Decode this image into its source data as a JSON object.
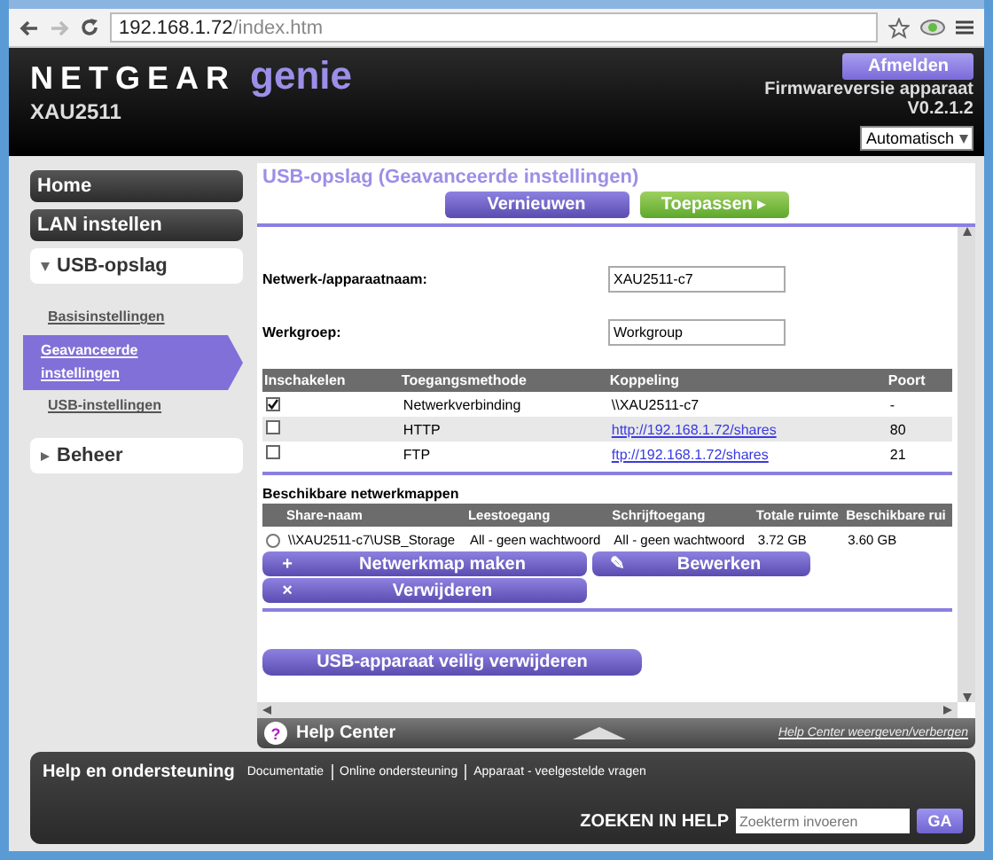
{
  "browser": {
    "url_host": "192.168.1.72",
    "url_path": "/index.htm"
  },
  "header": {
    "brand": "NETGEAR",
    "product": "genie",
    "model": "XAU2511",
    "logout": "Afmelden",
    "firmware_label": "Firmwareversie apparaat",
    "firmware_version": "V0.2.1.2",
    "language": "Automatisch"
  },
  "sidebar": {
    "items": [
      {
        "label": "Home",
        "kind": "button"
      },
      {
        "label": "LAN instellen",
        "kind": "button"
      },
      {
        "label": "USB-opslag",
        "kind": "group",
        "expanded": true,
        "children": [
          {
            "label": "Basisinstellingen",
            "selected": false
          },
          {
            "label": "Geavanceerde instellingen",
            "selected": true
          },
          {
            "label": "USB-instellingen",
            "selected": false
          }
        ]
      },
      {
        "label": "Beheer",
        "kind": "group",
        "expanded": false
      }
    ]
  },
  "page": {
    "title": "USB-opslag (Geavanceerde instellingen)",
    "refresh": "Vernieuwen",
    "apply": "Toepassen",
    "fields": [
      {
        "label": "Netwerk-/apparaatnaam:",
        "value": "XAU2511-c7"
      },
      {
        "label": "Werkgroep:",
        "value": "Workgroup"
      }
    ],
    "access_table": {
      "columns": [
        "Inschakelen",
        "Toegangsmethode",
        "Koppeling",
        "Poort"
      ],
      "rows": [
        {
          "kind": "text",
          "checked": true,
          "method": "Netwerkverbinding",
          "link": "\\\\XAU2511-c7",
          "port": "-"
        },
        {
          "kind": "link",
          "checked": false,
          "method": "HTTP",
          "link": "http://192.168.1.72/shares",
          "port": "80"
        },
        {
          "kind": "link",
          "checked": false,
          "method": "FTP",
          "link": "ftp://192.168.1.72/shares",
          "port": "21"
        }
      ]
    },
    "shares": {
      "title": "Beschikbare netwerkmappen",
      "columns": [
        "Share-naam",
        "Leestoegang",
        "Schrijftoegang",
        "Totale ruimte",
        "Beschikbare rui"
      ],
      "rows": [
        {
          "selected": false,
          "cells": [
            "\\\\XAU2511-c7\\USB_Storage",
            "All - geen wachtwoord",
            "All - geen wachtwoord",
            "3.72 GB",
            "3.60 GB"
          ]
        }
      ],
      "buttons": [
        {
          "label": "Netwerkmap maken",
          "icon": "+"
        },
        {
          "label": "Bewerken",
          "icon": "✎"
        },
        {
          "label": "Verwijderen",
          "icon": "×"
        }
      ]
    },
    "eject": "USB-apparaat veilig verwijderen"
  },
  "help_center": {
    "icon": "?",
    "title": "Help Center",
    "toggle": "Help Center weergeven/verbergen"
  },
  "footer": {
    "title": "Help en ondersteuning",
    "links": [
      "Documentatie",
      "Online ondersteuning",
      "Apparaat - veelgestelde vragen"
    ],
    "search_label": "ZOEKEN IN HELP",
    "search_placeholder": "Zoekterm invoeren",
    "search_button": "GA"
  }
}
